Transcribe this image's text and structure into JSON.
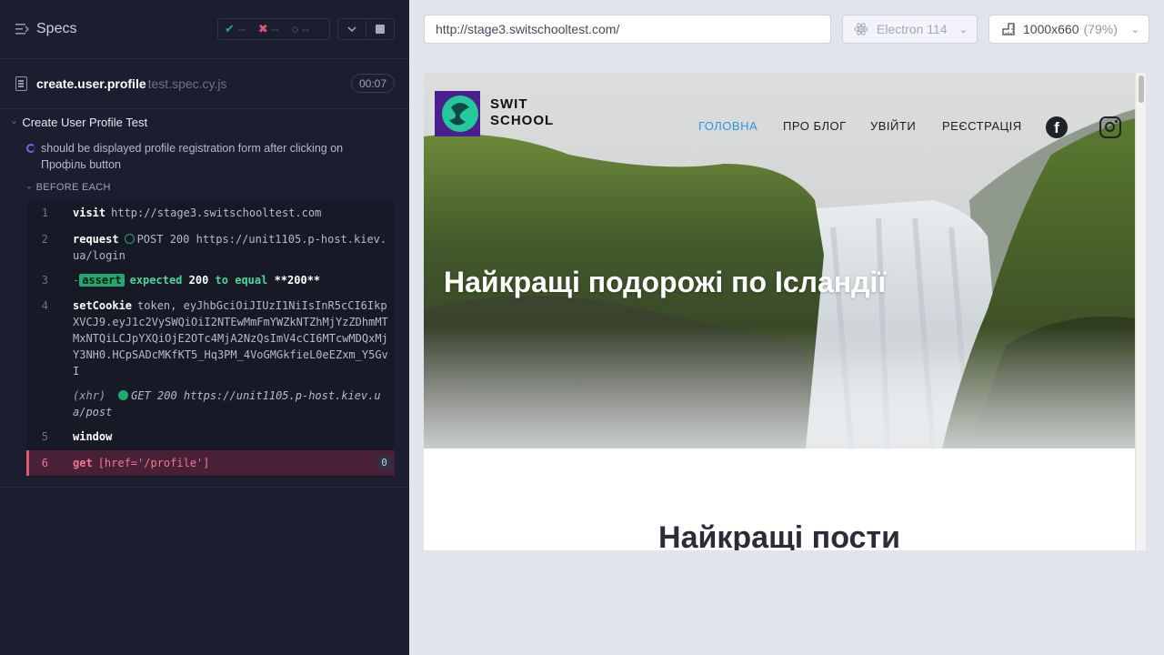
{
  "reporter": {
    "header": {
      "title": "Specs",
      "icon": "list-icon"
    },
    "stats": {
      "passed": "--",
      "failed": "--",
      "pending": "--"
    },
    "spec": {
      "name": "create.user.profile",
      "ext": "test.spec.cy.js",
      "duration": "00:07"
    },
    "suite": {
      "title": "Create User Profile Test"
    },
    "test": {
      "title": "should be displayed profile registration form after clicking on Профіль button"
    },
    "hook": {
      "label": "BEFORE EACH"
    },
    "commands": [
      {
        "num": "1",
        "name": "visit",
        "message": "http://stage3.switschooltest.com"
      },
      {
        "num": "2",
        "name": "request",
        "message": "POST 200 https://unit1105.p-host.kiev.ua/login"
      },
      {
        "num": "3",
        "name": "-",
        "badge": "assert",
        "message_parts": [
          "expected",
          "200",
          "to equal",
          "**200**"
        ]
      },
      {
        "num": "4",
        "name": "setCookie",
        "message": "token, eyJhbGciOiJIUzI1NiIsInR5cCI6IkpXVCJ9.eyJ1c2VySWQiOiI2NTEwMmFmYWZkNTZhMjYzZDhmMTMxNTQiLCJpYXQiOjE2OTc4MjA2NzQsImV4cCI6MTcwMDQxMjY3NH0.HCpSADcMKfKT5_Hq3PM_4VoGMGkfieL0eEZxm_Y5GvI"
      },
      {
        "num": "",
        "name": "(xhr)",
        "message": "GET 200 https://unit1105.p-host.kiev.ua/post"
      },
      {
        "num": "5",
        "name": "window",
        "message": ""
      },
      {
        "num": "6",
        "name": "get",
        "message": "[href='/profile']",
        "count": "0"
      }
    ]
  },
  "toolbar": {
    "url": "http://stage3.switschooltest.com/",
    "browser": "Electron 114",
    "viewport": "1000x660",
    "scale": "(79%)"
  },
  "aut": {
    "logo_line1": "SWIT",
    "logo_line2": "SCHOOL",
    "nav": [
      "ГОЛОВНА",
      "ПРО БЛОГ",
      "УВІЙТИ",
      "РЕЄСТРАЦІЯ"
    ],
    "nav_active_color": "#2d96e3",
    "hero_title": "Найкращі подорожі по Ісландії",
    "section_title": "Найкращі пости"
  },
  "colors": {
    "reporter_bg": "#1b1e2e",
    "pass": "#1fa971",
    "fail": "#e45770",
    "running": "#6b6fe0"
  }
}
